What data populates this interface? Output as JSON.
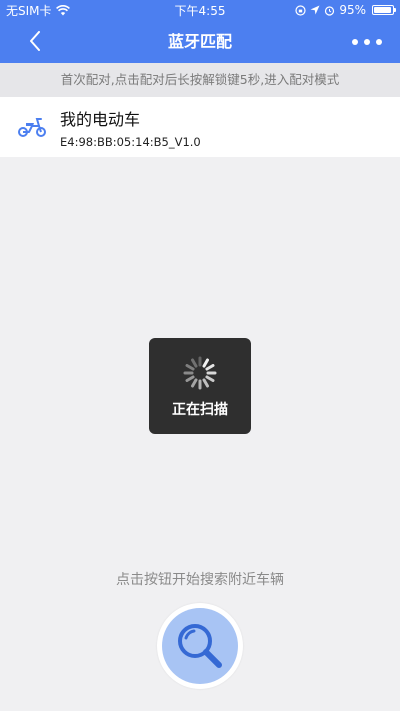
{
  "status_bar": {
    "carrier": "无SIM卡",
    "wifi_icon": "wifi-icon",
    "time": "下午4:55",
    "battery_percent": "95%",
    "battery_level": 0.95
  },
  "nav": {
    "title": "蓝牙匹配",
    "back_icon": "chevron-left-icon",
    "more_icon": "more-dots-icon"
  },
  "hint": "首次配对,点击配对后长按解锁键5秒,进入配对模式",
  "device": {
    "icon": "electric-scooter-icon",
    "name": "我的电动车",
    "mac": "E4:98:BB:05:14:B5_V1.0"
  },
  "toast": {
    "label": "正在扫描",
    "icon": "loading-spinner-icon"
  },
  "search": {
    "hint": "点击按钮开始搜索附近车辆",
    "icon": "magnifier-icon"
  },
  "colors": {
    "brand_blue": "#4c7ff0",
    "search_fill": "#a8c4f4",
    "search_icon": "#3569d4"
  }
}
